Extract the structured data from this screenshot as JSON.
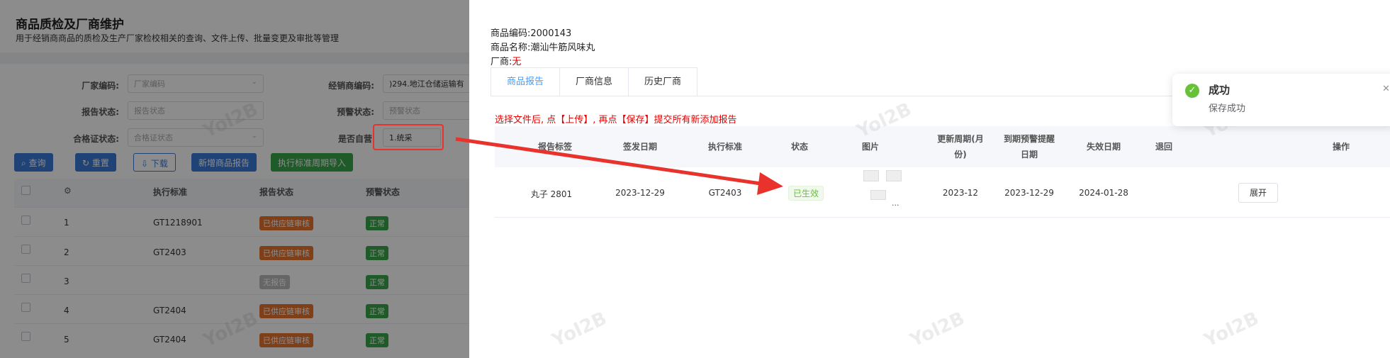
{
  "page": {
    "title": "商品质检及厂商维护",
    "subtitle": "用于经销商商品的质检及生产厂家检校相关的查询、文件上传、批量变更及审批等管理"
  },
  "filters": {
    "manufacturer_code_label": "厂家编码:",
    "manufacturer_code_placeholder": "厂家编码",
    "dealer_code_label": "经销商编码:",
    "dealer_code_value": ")294.地江仓储运输有",
    "report_status_label": "报告状态:",
    "report_status_placeholder": "报告状态",
    "warning_status_label": "预警状态:",
    "warning_status_placeholder": "预警状态",
    "cert_status_label": "合格证状态:",
    "cert_status_placeholder": "合格证状态",
    "self_operated_label": "是否自营",
    "self_operated_value": "1.统采"
  },
  "toolbar": {
    "query": "查询",
    "reset": "重置",
    "download": "下载",
    "add_report": "新增商品报告",
    "import_cycle": "执行标准周期导入"
  },
  "table": {
    "headers": [
      "执行标准",
      "报告状态",
      "预警状态"
    ],
    "rows": [
      {
        "index": "1",
        "standard": "GT1218901",
        "report_status": "已供应链审核",
        "warning": "正常"
      },
      {
        "index": "2",
        "standard": "GT2403",
        "report_status": "已供应链审核",
        "warning": "正常"
      },
      {
        "index": "3",
        "standard": "",
        "report_status": "无报告",
        "warning": "正常"
      },
      {
        "index": "4",
        "standard": "GT2404",
        "report_status": "已供应链审核",
        "warning": "正常"
      },
      {
        "index": "5",
        "standard": "GT2404",
        "report_status": "已供应链审核",
        "warning": "正常"
      }
    ]
  },
  "watermark": "Yol2B",
  "drawer": {
    "product_code_label": "商品编码:",
    "product_code": "2000143",
    "product_name_label": "商品名称:",
    "product_name": "潮汕牛筋风味丸",
    "manufacturer_label": "厂商:",
    "manufacturer": "无",
    "tabs": [
      "商品报告",
      "厂商信息",
      "历史厂商"
    ],
    "notice": "选择文件后, 点【上传】, 再点【保存】提交所有新添加报告",
    "columns": {
      "report_label": "报告标签",
      "issue_date": "签发日期",
      "standard": "执行标准",
      "status": "状态",
      "image": "图片",
      "update_cycle_1": "更新周期(月",
      "update_cycle_2": "份)",
      "expiry_warning_1": "到期预警提醒",
      "expiry_warning_2": "日期",
      "expiry_date": "失效日期",
      "return": "退回",
      "operation": "操作"
    },
    "row": {
      "report_label": "丸子 2801",
      "issue_date": "2023-12-29",
      "standard": "GT2403",
      "status": "已生效",
      "image_more": "...",
      "update_cycle": "2023-12",
      "expiry_warning": "2023-12-29",
      "expiry_date": "2024-01-28",
      "return": "",
      "expand": "展开"
    }
  },
  "toast": {
    "title": "成功",
    "message": "保存成功"
  },
  "colors": {
    "primary": "#409eff",
    "button_blue": "#3a7ad9",
    "success": "#67c23a",
    "danger_red": "#e8322b",
    "tag_orange": "#e6732e",
    "tag_green": "#3aa54b"
  }
}
